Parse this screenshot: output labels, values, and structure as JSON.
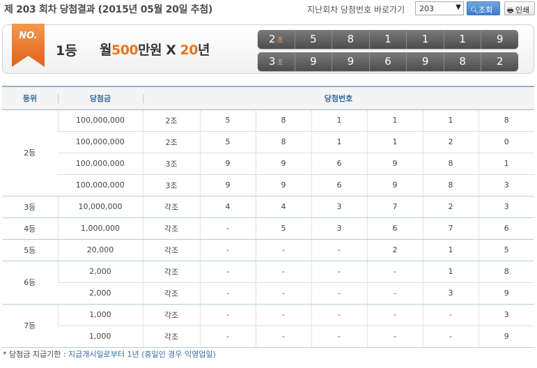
{
  "header": {
    "title": "제 203 회차 당첨결과 (2015년 05월 20일 추첨)",
    "goto_label": "지난회차 당첨번호 바로가기",
    "round_select_value": "203",
    "search_label": "조회",
    "print_label": "인쇄"
  },
  "banner": {
    "badge": "NO.",
    "rank": "1등",
    "prize_prefix": "월",
    "prize_amount": "500",
    "prize_unit": "만원",
    "prize_x": "X",
    "prize_years": "20",
    "prize_years_unit": "년",
    "rows": [
      {
        "group": "2",
        "group_suffix": "조",
        "numbers": [
          "5",
          "8",
          "1",
          "1",
          "1",
          "9"
        ]
      },
      {
        "group": "3",
        "group_suffix": "조",
        "numbers": [
          "9",
          "9",
          "6",
          "9",
          "8",
          "2"
        ]
      }
    ]
  },
  "table": {
    "headers": {
      "rank": "등위",
      "prize": "당첨금",
      "numbers": "당첨번호"
    },
    "groups": [
      {
        "rank": "2등",
        "rows": [
          {
            "prize": "100,000,000",
            "group": "2조",
            "nums": [
              "5",
              "8",
              "1",
              "1",
              "1",
              "8"
            ]
          },
          {
            "prize": "100,000,000",
            "group": "2조",
            "nums": [
              "5",
              "8",
              "1",
              "1",
              "2",
              "0"
            ]
          },
          {
            "prize": "100,000,000",
            "group": "3조",
            "nums": [
              "9",
              "9",
              "6",
              "9",
              "8",
              "1"
            ]
          },
          {
            "prize": "100,000,000",
            "group": "3조",
            "nums": [
              "9",
              "9",
              "6",
              "9",
              "8",
              "3"
            ]
          }
        ]
      },
      {
        "rank": "3등",
        "rows": [
          {
            "prize": "10,000,000",
            "group": "각조",
            "nums": [
              "4",
              "4",
              "3",
              "7",
              "2",
              "3"
            ]
          }
        ]
      },
      {
        "rank": "4등",
        "rows": [
          {
            "prize": "1,000,000",
            "group": "각조",
            "nums": [
              "-",
              "5",
              "3",
              "6",
              "7",
              "6"
            ]
          }
        ]
      },
      {
        "rank": "5등",
        "rows": [
          {
            "prize": "20,000",
            "group": "각조",
            "nums": [
              "-",
              "-",
              "-",
              "2",
              "1",
              "5"
            ]
          }
        ]
      },
      {
        "rank": "6등",
        "rows": [
          {
            "prize": "2,000",
            "group": "각조",
            "nums": [
              "-",
              "-",
              "-",
              "-",
              "1",
              "8"
            ]
          },
          {
            "prize": "2,000",
            "group": "각조",
            "nums": [
              "-",
              "-",
              "-",
              "-",
              "3",
              "9"
            ]
          }
        ]
      },
      {
        "rank": "7등",
        "rows": [
          {
            "prize": "1,000",
            "group": "각조",
            "nums": [
              "-",
              "-",
              "-",
              "-",
              "-",
              "3"
            ]
          },
          {
            "prize": "1,000",
            "group": "각조",
            "nums": [
              "-",
              "-",
              "-",
              "-",
              "-",
              "9"
            ]
          }
        ]
      }
    ]
  },
  "footnote": {
    "label": "* 당첨금 지급기한 :",
    "text": "지급개시일로부터 1년 (휴일인 경우 익영업일)"
  },
  "colors": {
    "accent_orange": "#e8751f",
    "header_blue": "#356a9e",
    "number_bar": "#5e5e5e"
  }
}
